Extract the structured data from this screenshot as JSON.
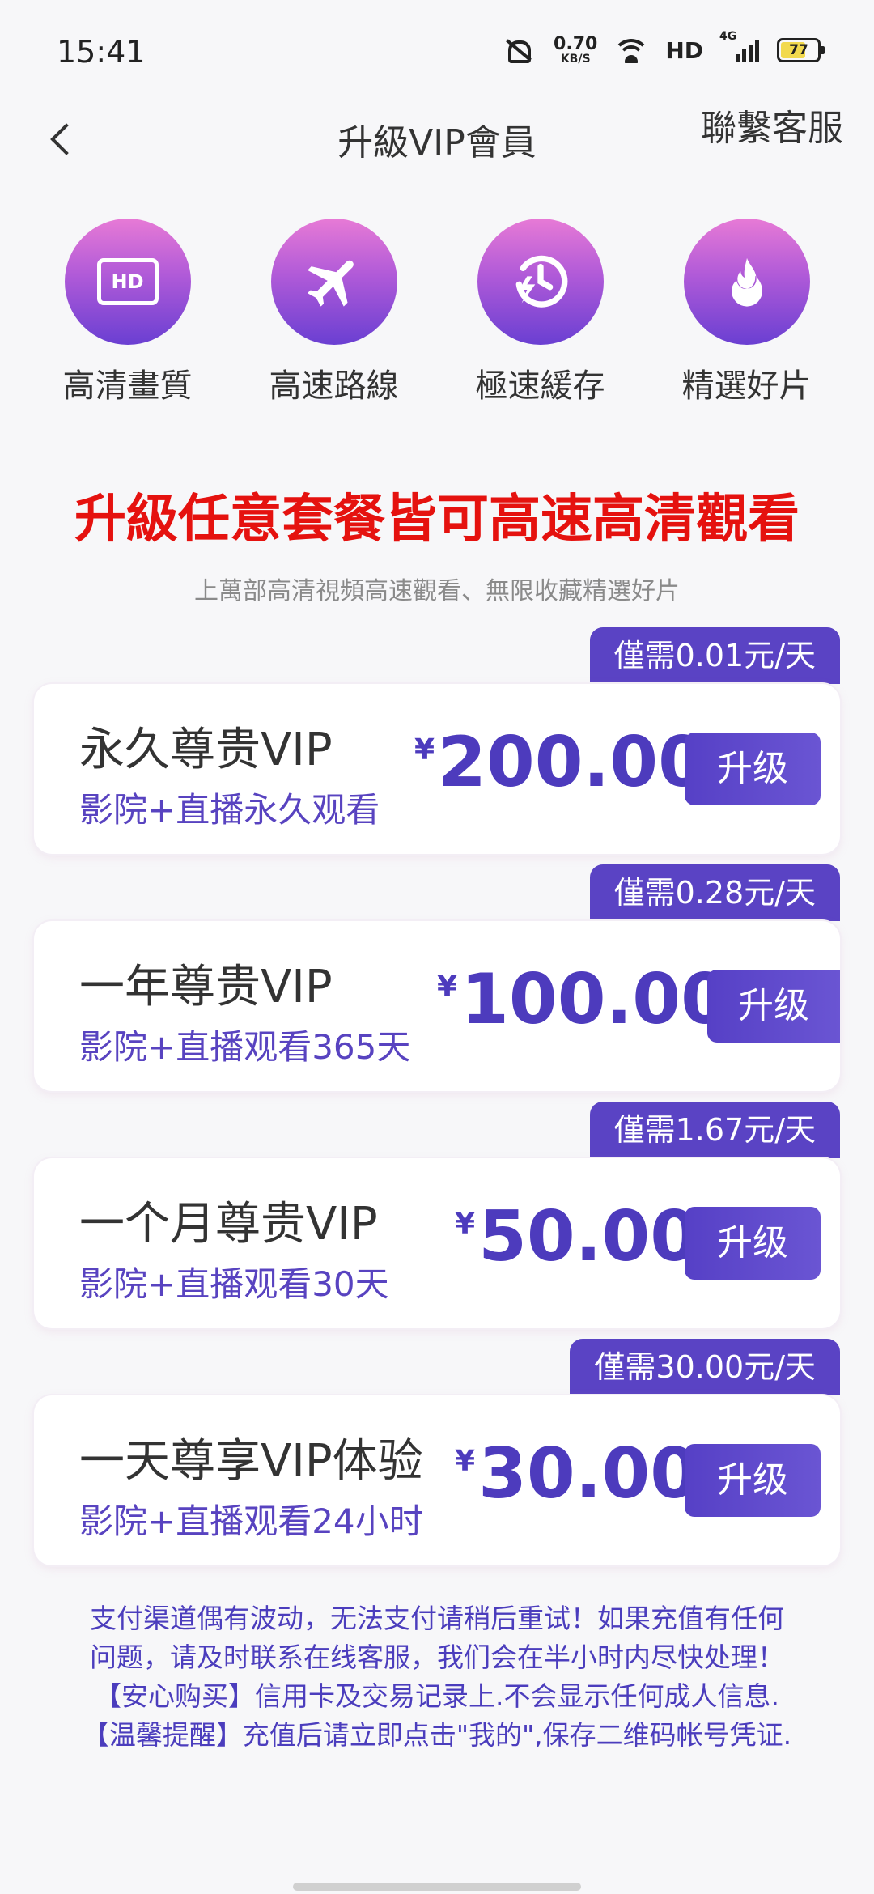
{
  "status": {
    "time": "15:41",
    "net_value": "0.70",
    "net_unit": "KB/S",
    "hd": "HD",
    "network": "4G",
    "battery": "77"
  },
  "header": {
    "title": "升級VIP會員",
    "service": "聯繫客服"
  },
  "features": [
    {
      "label": "高清畫質",
      "icon": "hd-icon",
      "hd_text": "HD"
    },
    {
      "label": "高速路線",
      "icon": "airplane-icon"
    },
    {
      "label": "極速緩存",
      "icon": "lightning-clock-icon"
    },
    {
      "label": "精選好片",
      "icon": "fire-icon"
    }
  ],
  "headline": "升級任意套餐皆可高速高清觀看",
  "subline": "上萬部高清視頻高速觀看、無限收藏精選好片",
  "plans": [
    {
      "tag": "僅需0.01元/天",
      "name": "永久尊贵VIP",
      "desc": "影院+直播永久观看",
      "currency": "¥",
      "price": "200.00",
      "button": "升级"
    },
    {
      "tag": "僅需0.28元/天",
      "name": "一年尊贵VIP",
      "desc": "影院+直播观看365天",
      "currency": "¥",
      "price": "100.00",
      "button": "升级"
    },
    {
      "tag": "僅需1.67元/天",
      "name": "一个月尊贵VIP",
      "desc": "影院+直播观看30天",
      "currency": "¥",
      "price": "50.00",
      "button": "升级"
    },
    {
      "tag": "僅需30.00元/天",
      "name": "一天尊享VIP体验",
      "desc": "影院+直播观看24小时",
      "currency": "¥",
      "price": "30.00",
      "button": "升级"
    }
  ],
  "notice": [
    "支付渠道偶有波动，无法支付请稍后重试！如果充值有任何",
    "问题，请及时联系在线客服，我们会在半小时内尽快处理！",
    "【安心购买】信用卡及交易记录上.不会显示任何成人信息.",
    "【温馨提醒】充值后请立即点击\"我的\",保存二维码帐号凭证."
  ],
  "colors": {
    "accent": "#5a43c4",
    "headline": "#e5120f",
    "icon_gradient_top": "#e77ad6",
    "icon_gradient_bottom": "#6a3fd2"
  }
}
